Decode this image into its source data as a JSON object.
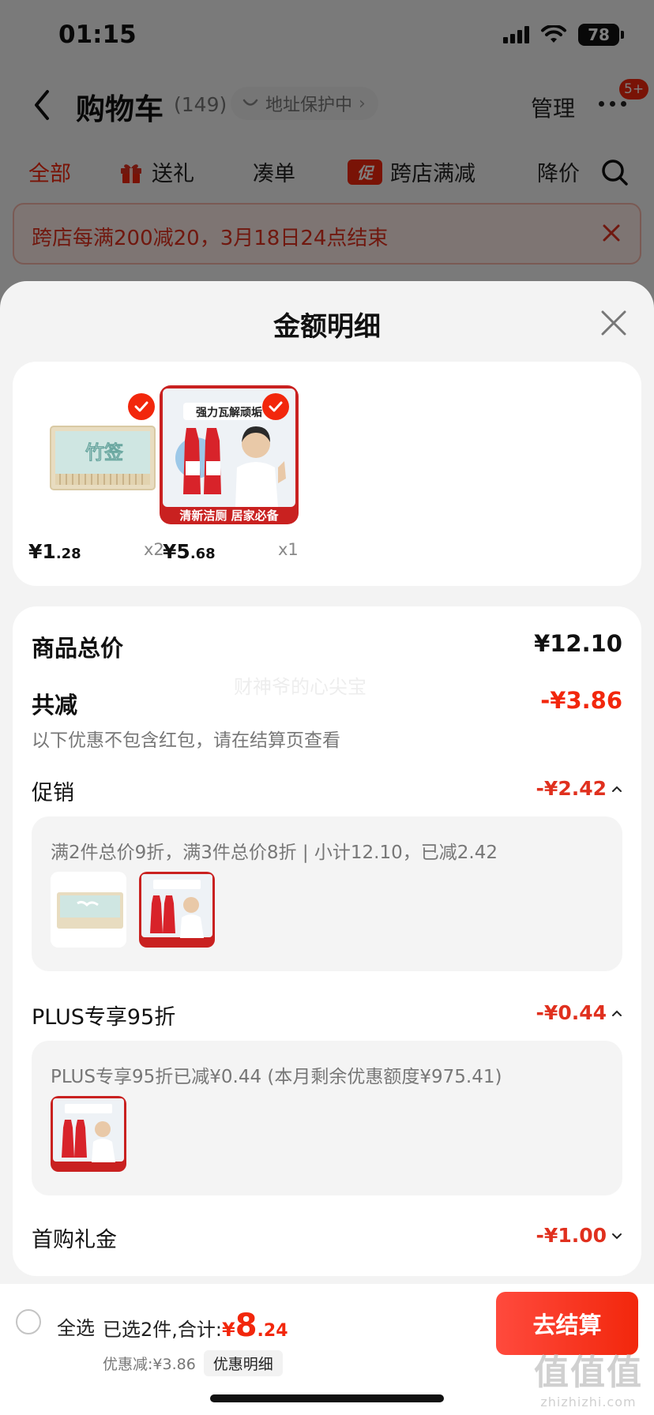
{
  "status_bar": {
    "time": "01:15",
    "battery": "78"
  },
  "nav": {
    "title": "购物车",
    "count": "(149)",
    "address_pill": "地址保护中",
    "manage": "管理",
    "badge": "5+"
  },
  "tabs": [
    {
      "label": "全部"
    },
    {
      "label": "送礼"
    },
    {
      "label": "凑单"
    },
    {
      "label": "跨店满减",
      "badge": "促"
    },
    {
      "label": "降价"
    }
  ],
  "promo_banner": {
    "text": "跨店每满200减20，3月18日24点结束"
  },
  "sheet": {
    "title": "金额明细",
    "watermark": "财神爷的心尖宝",
    "products": [
      {
        "price_int": "1",
        "price_dec": ".28",
        "qty": "x2",
        "currency": "¥"
      },
      {
        "price_int": "5",
        "price_dec": ".68",
        "qty": "x1",
        "currency": "¥"
      }
    ],
    "product_image_texts": {
      "toothpick_brand": "竹签",
      "cleaner_top": "强力瓦解顽垢",
      "cleaner_bottom": "清新洁厕 居家必备"
    },
    "subtotal": {
      "label": "商品总价",
      "value": "¥12.10"
    },
    "total_discount": {
      "label": "共减",
      "value": "-¥3.86",
      "note": "以下优惠不包含红包，请在结算页查看"
    },
    "promotion": {
      "label": "促销",
      "value": "-¥2.42",
      "detail": "满2件总价9折，满3件总价8折 | 小计12.10，已减2.42"
    },
    "plus": {
      "label": "PLUS专享95折",
      "value": "-¥0.44",
      "detail": "PLUS专享95折已减¥0.44 (本月剩余优惠额度¥975.41)"
    },
    "first_purchase": {
      "label": "首购礼金",
      "value": "-¥1.00"
    }
  },
  "bottom_bar": {
    "select_all": "全选",
    "selected_text": "已选2件,合计:",
    "total_currency": "¥",
    "total_int": "8",
    "total_dec": ".24",
    "discount_text": "优惠减:¥3.86",
    "detail_button": "优惠明细",
    "checkout_button": "去结算",
    "corner_watermark_big": "值值值",
    "corner_watermark_small": "zhizhizhi.com"
  },
  "colors": {
    "accent": "#f2270c",
    "discount_red": "#e0301e",
    "sheet_bg": "#f3f3f3"
  }
}
